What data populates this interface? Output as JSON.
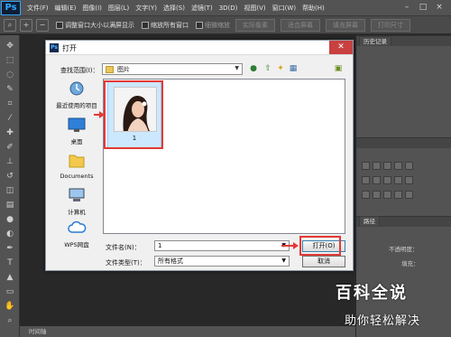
{
  "app": {
    "logo": "Ps",
    "menu": [
      "文件(F)",
      "编辑(E)",
      "图像(I)",
      "图层(L)",
      "文字(Y)",
      "选择(S)",
      "滤镜(T)",
      "3D(D)",
      "视图(V)",
      "窗口(W)",
      "帮助(H)"
    ]
  },
  "options_bar": {
    "resize_windows_label": "调整窗口大小以满屏显示",
    "zoom_all_label": "缩放所有窗口",
    "scrubby_zoom_label": "细微缩放",
    "actual_pixels": "实际像素",
    "fit_screen": "适合屏幕",
    "fill_screen": "填充屏幕",
    "print_size": "打印尺寸"
  },
  "panels": {
    "history_tab": "历史记录",
    "layers_tab": "路径",
    "opacity_label": "不透明度：",
    "fill_label": "填充："
  },
  "status_bar": {
    "timeline": "时间轴"
  },
  "dialog": {
    "title": "打开",
    "look_in_label": "查找范围(I)：",
    "look_in_value": "图片",
    "places": [
      {
        "label": "最近使用的项目",
        "icon": "recent-items-icon"
      },
      {
        "label": "桌面",
        "icon": "desktop-icon"
      },
      {
        "label": "Documents",
        "icon": "documents-folder-icon"
      },
      {
        "label": "计算机",
        "icon": "computer-icon"
      },
      {
        "label": "WPS网盘",
        "icon": "wps-cloud-icon"
      }
    ],
    "files": [
      {
        "name": "1",
        "selected": true
      }
    ],
    "file_name_label": "文件名(N)：",
    "file_name_value": "1",
    "file_type_label": "文件类型(T)：",
    "file_type_value": "所有格式",
    "open_button": "打开(O)",
    "cancel_button": "取消"
  },
  "watermark": {
    "title": "百科全说",
    "subtitle": "助你轻松解决"
  },
  "colors": {
    "highlight_red": "#e53935",
    "selection_blue": "#cce8ff",
    "ps_dark": "#535353"
  }
}
